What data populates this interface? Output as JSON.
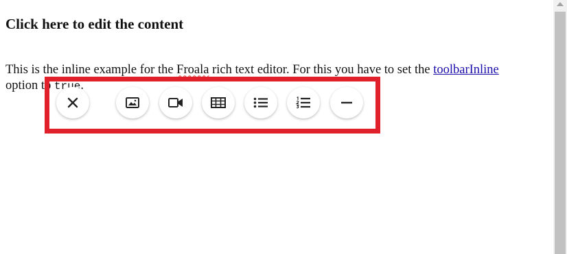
{
  "editor": {
    "heading": "Click here to edit the content",
    "para_prefix": "This is the inline example for the ",
    "froala": "Froala",
    "para_middle": " rich text editor. For this you have to set the ",
    "link_text": "toolbarInline",
    "para_suffix": " option to ",
    "code_value": "true",
    "para_end": "."
  },
  "toolbar": {
    "buttons": [
      {
        "name": "close",
        "icon": "close-icon"
      },
      {
        "name": "insert-image",
        "icon": "image-icon"
      },
      {
        "name": "insert-video",
        "icon": "video-icon"
      },
      {
        "name": "insert-table",
        "icon": "table-icon"
      },
      {
        "name": "unordered-list",
        "icon": "bulleted-list-icon"
      },
      {
        "name": "ordered-list",
        "icon": "numbered-list-icon"
      },
      {
        "name": "horizontal-line",
        "icon": "horizontal-line-icon"
      }
    ]
  },
  "colors": {
    "highlight_border": "#e0212b",
    "icon": "#222222",
    "link": "#1a0dab"
  }
}
